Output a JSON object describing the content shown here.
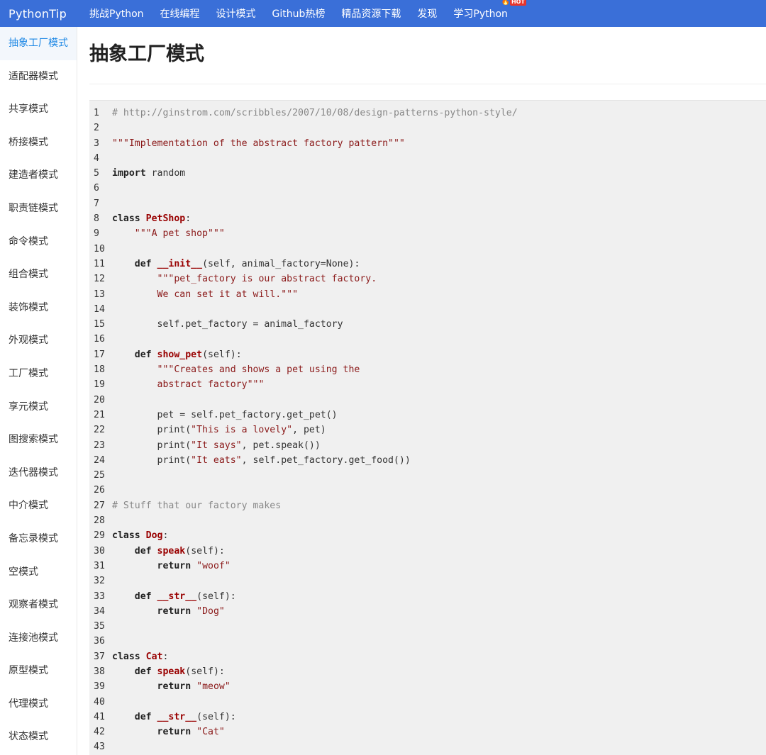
{
  "topbar": {
    "brand": "PythonTip",
    "nav": [
      "挑战Python",
      "在线编程",
      "设计模式",
      "Github热榜",
      "精品资源下载",
      "发现",
      "学习Python"
    ],
    "hot_badge": "HOT"
  },
  "sidebar": {
    "items": [
      "抽象工厂模式",
      "适配器模式",
      "共享模式",
      "桥接模式",
      "建造者模式",
      "职责链模式",
      "命令模式",
      "组合模式",
      "装饰模式",
      "外观模式",
      "工厂模式",
      "享元模式",
      "图搜索模式",
      "迭代器模式",
      "中介模式",
      "备忘录模式",
      "空模式",
      "观察者模式",
      "连接池模式",
      "原型模式",
      "代理模式",
      "状态模式"
    ],
    "active_index": 0
  },
  "main": {
    "title": "抽象工厂模式"
  },
  "code": {
    "lines": [
      [
        {
          "t": "# http://ginstrom.com/scribbles/2007/10/08/design-patterns-python-style/",
          "c": "com"
        }
      ],
      [],
      [
        {
          "t": "\"\"\"Implementation of the abstract factory pattern\"\"\"",
          "c": "str"
        }
      ],
      [],
      [
        {
          "t": "import",
          "c": "kw"
        },
        {
          "t": " random",
          "c": "plain"
        }
      ],
      [],
      [],
      [
        {
          "t": "class",
          "c": "kw"
        },
        {
          "t": " ",
          "c": "plain"
        },
        {
          "t": "PetShop",
          "c": "def"
        },
        {
          "t": ":",
          "c": "plain"
        }
      ],
      [
        {
          "t": "    ",
          "c": "plain"
        },
        {
          "t": "\"\"\"A pet shop\"\"\"",
          "c": "str"
        }
      ],
      [],
      [
        {
          "t": "    ",
          "c": "plain"
        },
        {
          "t": "def",
          "c": "kw"
        },
        {
          "t": " ",
          "c": "plain"
        },
        {
          "t": "__init__",
          "c": "def"
        },
        {
          "t": "(self, animal_factory=None):",
          "c": "plain"
        }
      ],
      [
        {
          "t": "        ",
          "c": "plain"
        },
        {
          "t": "\"\"\"pet_factory is our abstract factory.",
          "c": "str"
        }
      ],
      [
        {
          "t": "        ",
          "c": "plain"
        },
        {
          "t": "We can set it at will.\"\"\"",
          "c": "str"
        }
      ],
      [],
      [
        {
          "t": "        self.pet_factory = animal_factory",
          "c": "plain"
        }
      ],
      [],
      [
        {
          "t": "    ",
          "c": "plain"
        },
        {
          "t": "def",
          "c": "kw"
        },
        {
          "t": " ",
          "c": "plain"
        },
        {
          "t": "show_pet",
          "c": "def"
        },
        {
          "t": "(self):",
          "c": "plain"
        }
      ],
      [
        {
          "t": "        ",
          "c": "plain"
        },
        {
          "t": "\"\"\"Creates and shows a pet using the",
          "c": "str"
        }
      ],
      [
        {
          "t": "        ",
          "c": "plain"
        },
        {
          "t": "abstract factory\"\"\"",
          "c": "str"
        }
      ],
      [],
      [
        {
          "t": "        pet = self.pet_factory.get_pet()",
          "c": "plain"
        }
      ],
      [
        {
          "t": "        print(",
          "c": "plain"
        },
        {
          "t": "\"This is a lovely\"",
          "c": "str"
        },
        {
          "t": ", pet)",
          "c": "plain"
        }
      ],
      [
        {
          "t": "        print(",
          "c": "plain"
        },
        {
          "t": "\"It says\"",
          "c": "str"
        },
        {
          "t": ", pet.speak())",
          "c": "plain"
        }
      ],
      [
        {
          "t": "        print(",
          "c": "plain"
        },
        {
          "t": "\"It eats\"",
          "c": "str"
        },
        {
          "t": ", self.pet_factory.get_food())",
          "c": "plain"
        }
      ],
      [],
      [],
      [
        {
          "t": "# Stuff that our factory makes",
          "c": "com"
        }
      ],
      [],
      [
        {
          "t": "class",
          "c": "kw"
        },
        {
          "t": " ",
          "c": "plain"
        },
        {
          "t": "Dog",
          "c": "def"
        },
        {
          "t": ":",
          "c": "plain"
        }
      ],
      [
        {
          "t": "    ",
          "c": "plain"
        },
        {
          "t": "def",
          "c": "kw"
        },
        {
          "t": " ",
          "c": "plain"
        },
        {
          "t": "speak",
          "c": "def"
        },
        {
          "t": "(self):",
          "c": "plain"
        }
      ],
      [
        {
          "t": "        ",
          "c": "plain"
        },
        {
          "t": "return",
          "c": "kw"
        },
        {
          "t": " ",
          "c": "plain"
        },
        {
          "t": "\"woof\"",
          "c": "str"
        }
      ],
      [],
      [
        {
          "t": "    ",
          "c": "plain"
        },
        {
          "t": "def",
          "c": "kw"
        },
        {
          "t": " ",
          "c": "plain"
        },
        {
          "t": "__str__",
          "c": "def"
        },
        {
          "t": "(self):",
          "c": "plain"
        }
      ],
      [
        {
          "t": "        ",
          "c": "plain"
        },
        {
          "t": "return",
          "c": "kw"
        },
        {
          "t": " ",
          "c": "plain"
        },
        {
          "t": "\"Dog\"",
          "c": "str"
        }
      ],
      [],
      [],
      [
        {
          "t": "class",
          "c": "kw"
        },
        {
          "t": " ",
          "c": "plain"
        },
        {
          "t": "Cat",
          "c": "def"
        },
        {
          "t": ":",
          "c": "plain"
        }
      ],
      [
        {
          "t": "    ",
          "c": "plain"
        },
        {
          "t": "def",
          "c": "kw"
        },
        {
          "t": " ",
          "c": "plain"
        },
        {
          "t": "speak",
          "c": "def"
        },
        {
          "t": "(self):",
          "c": "plain"
        }
      ],
      [
        {
          "t": "        ",
          "c": "plain"
        },
        {
          "t": "return",
          "c": "kw"
        },
        {
          "t": " ",
          "c": "plain"
        },
        {
          "t": "\"meow\"",
          "c": "str"
        }
      ],
      [],
      [
        {
          "t": "    ",
          "c": "plain"
        },
        {
          "t": "def",
          "c": "kw"
        },
        {
          "t": " ",
          "c": "plain"
        },
        {
          "t": "__str__",
          "c": "def"
        },
        {
          "t": "(self):",
          "c": "plain"
        }
      ],
      [
        {
          "t": "        ",
          "c": "plain"
        },
        {
          "t": "return",
          "c": "kw"
        },
        {
          "t": " ",
          "c": "plain"
        },
        {
          "t": "\"Cat\"",
          "c": "str"
        }
      ],
      []
    ]
  }
}
